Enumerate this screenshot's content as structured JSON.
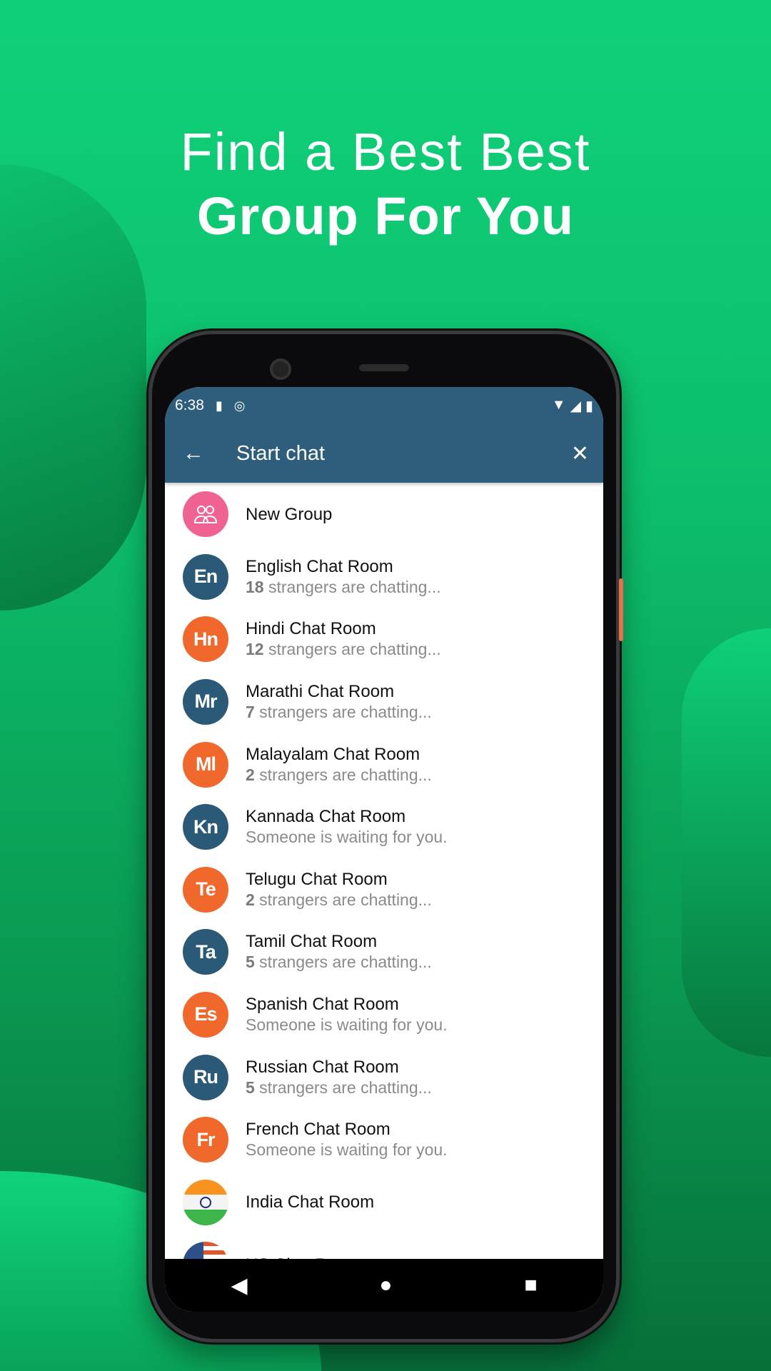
{
  "headline": {
    "line1": "Find a Best Best",
    "line2": "Group For You"
  },
  "status_bar": {
    "time": "6:38"
  },
  "app_bar": {
    "title": "Start chat",
    "back_icon": "arrow-left-icon",
    "close_icon": "close-icon"
  },
  "colors": {
    "app_bar": "#2f5d7c",
    "avatar_blue": "#2b5a78",
    "avatar_orange": "#f0682c",
    "new_group": "#f06292",
    "background": "#10d07a"
  },
  "rooms": [
    {
      "name": "New Group",
      "avatar": "group-icon",
      "color": "#f06292"
    },
    {
      "name": "English Chat Room",
      "abbr": "En",
      "count": "18",
      "status": " strangers are chatting...",
      "color": "#2b5a78"
    },
    {
      "name": "Hindi Chat Room",
      "abbr": "Hn",
      "count": "12",
      "status": " strangers are chatting...",
      "color": "#f0682c"
    },
    {
      "name": "Marathi Chat Room",
      "abbr": "Mr",
      "count": "7",
      "status": " strangers are chatting...",
      "color": "#2b5a78"
    },
    {
      "name": "Malayalam Chat Room",
      "abbr": "Ml",
      "count": "2",
      "status": " strangers are chatting...",
      "color": "#f0682c"
    },
    {
      "name": "Kannada Chat Room",
      "abbr": "Kn",
      "status": "Someone is waiting for you.",
      "color": "#2b5a78"
    },
    {
      "name": "Telugu Chat Room",
      "abbr": "Te",
      "count": "2",
      "status": " strangers are chatting...",
      "color": "#f0682c"
    },
    {
      "name": "Tamil Chat Room",
      "abbr": "Ta",
      "count": "5",
      "status": " strangers are chatting...",
      "color": "#2b5a78"
    },
    {
      "name": "Spanish Chat Room",
      "abbr": "Es",
      "status": "Someone is waiting for you.",
      "color": "#f0682c"
    },
    {
      "name": "Russian Chat Room",
      "abbr": "Ru",
      "count": "5",
      "status": " strangers are chatting...",
      "color": "#2b5a78"
    },
    {
      "name": "French Chat Room",
      "abbr": "Fr",
      "status": "Someone is waiting for you.",
      "color": "#f0682c"
    },
    {
      "name": "India Chat Room",
      "avatar": "india-flag-icon"
    },
    {
      "name": "US Chat Room",
      "avatar": "us-flag-icon"
    }
  ]
}
